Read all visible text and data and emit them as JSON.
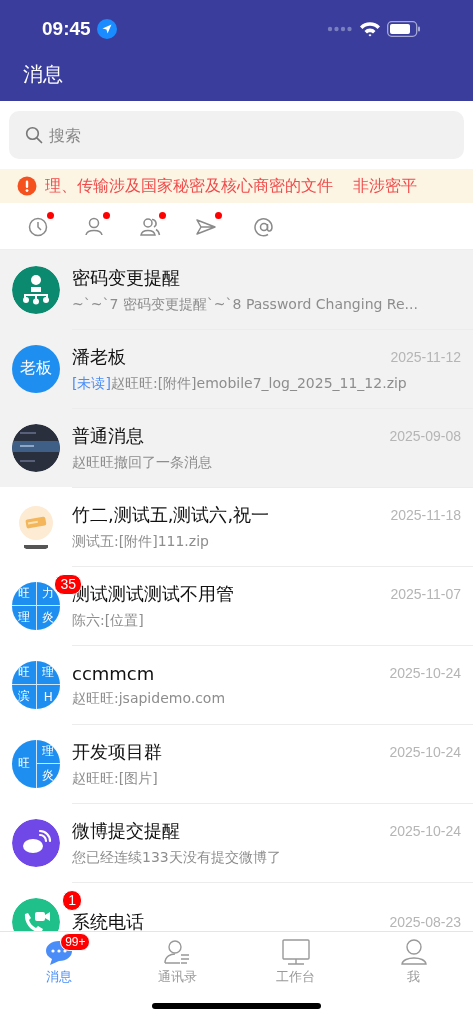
{
  "status_bar": {
    "time": "09:45"
  },
  "header": {
    "title": "消息"
  },
  "search": {
    "placeholder": "搜索"
  },
  "banner": {
    "segments": [
      "理、传输涉及国家秘密及核心商密的文件",
      "非涉密平"
    ]
  },
  "filters": [
    {
      "kind": "clock",
      "dot": true
    },
    {
      "kind": "person",
      "dot": true
    },
    {
      "kind": "group",
      "dot": true
    },
    {
      "kind": "send",
      "dot": true
    },
    {
      "kind": "at",
      "dot": false
    }
  ],
  "conversations": [
    {
      "avatar": {
        "kind": "org"
      },
      "pinned": true,
      "title": "密码变更提醒",
      "preview": "~`~`7 密码变更提醒`~`8 Password Changing Re..."
    },
    {
      "avatar": {
        "kind": "text",
        "text": "老板"
      },
      "pinned": true,
      "title": "潘老板",
      "date": "2025-11-12",
      "unread_tag": "[未读]",
      "preview": "赵旺旺:[附件]emobile7_log_2025_11_12.zip"
    },
    {
      "pinned": true,
      "title": "普通消息",
      "date": "2025-09-08",
      "preview": "赵旺旺撤回了一条消息"
    },
    {
      "pinned": false,
      "title": "竹二,测试五,测试六,祝一",
      "date": "2025-11-18",
      "preview": "测试五:[附件]111.zip"
    },
    {
      "avatar": {
        "kind": "grid",
        "cells": [
          "旺",
          "力",
          "理",
          "炎"
        ]
      },
      "pinned": false,
      "badge": "35",
      "title": "测试测试测试不用管",
      "date": "2025-11-07",
      "preview": "陈六:[位置]"
    },
    {
      "avatar": {
        "kind": "grid",
        "cells": [
          "旺",
          "理",
          "滨",
          "H"
        ]
      },
      "pinned": false,
      "title": "ccmmcm",
      "date": "2025-10-24",
      "preview": "赵旺旺:jsapidemo.com"
    },
    {
      "avatar": {
        "kind": "grid3",
        "cells": [
          "旺",
          "理",
          "炎"
        ]
      },
      "pinned": false,
      "title": "开发项目群",
      "date": "2025-10-24",
      "preview": "赵旺旺:[图片]"
    },
    {
      "avatar": {
        "kind": "weibo"
      },
      "pinned": false,
      "title": "微博提交提醒",
      "date": "2025-10-24",
      "preview": "您已经连续133天没有提交微博了"
    },
    {
      "avatar": {
        "kind": "phone"
      },
      "pinned": false,
      "badge": "1",
      "title": "系统电话",
      "date": "2025-08-23"
    }
  ],
  "tab_bar": [
    {
      "kind": "chat",
      "label": "消息",
      "selected": true,
      "badge": "99+"
    },
    {
      "kind": "contacts",
      "label": "通讯录",
      "selected": false
    },
    {
      "kind": "desk",
      "label": "工作台",
      "selected": false
    },
    {
      "kind": "me",
      "label": "我",
      "selected": false
    }
  ]
}
